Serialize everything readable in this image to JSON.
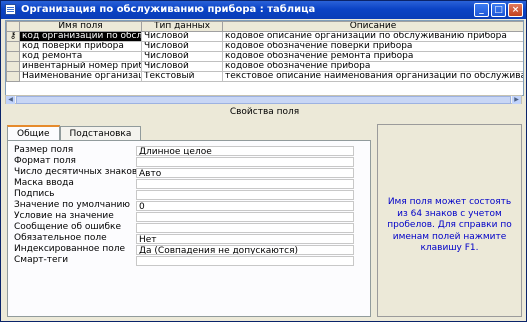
{
  "window": {
    "title": "Организация по обслуживанию прибора : таблица"
  },
  "grid": {
    "headers": [
      "Имя поля",
      "Тип данных",
      "Описание"
    ],
    "rows": [
      {
        "name": "код организации по обслуж",
        "type": "Числовой",
        "desc": "кодовое описание организации по обслуживанию прибора"
      },
      {
        "name": "код поверки прибора",
        "type": "Числовой",
        "desc": "кодовое обозначение поверки прибора"
      },
      {
        "name": "код ремонта",
        "type": "Числовой",
        "desc": "кодовое обозначение ремонта прибора"
      },
      {
        "name": "инвентарный номер прибор",
        "type": "Числовой",
        "desc": "кодовое обозначение прибора"
      },
      {
        "name": "Наименование организации",
        "type": "Текстовый",
        "desc": "текстовое описание наименования организации по обслуживанию п"
      }
    ]
  },
  "props": {
    "section_title": "Свойства поля",
    "tabs": [
      "Общие",
      "Подстановка"
    ],
    "items": [
      {
        "label": "Размер поля",
        "value": "Длинное целое"
      },
      {
        "label": "Формат поля",
        "value": ""
      },
      {
        "label": "Число десятичных знаков",
        "value": "Авто"
      },
      {
        "label": "Маска ввода",
        "value": ""
      },
      {
        "label": "Подпись",
        "value": ""
      },
      {
        "label": "Значение по умолчанию",
        "value": "0"
      },
      {
        "label": "Условие на значение",
        "value": ""
      },
      {
        "label": "Сообщение об ошибке",
        "value": ""
      },
      {
        "label": "Обязательное поле",
        "value": "Нет"
      },
      {
        "label": "Индексированное поле",
        "value": "Да (Совпадения не допускаются)"
      },
      {
        "label": "Смарт-теги",
        "value": ""
      }
    ]
  },
  "help": {
    "text": "Имя поля может состоять из 64 знаков с учетом пробелов. Для справки по именам полей нажмите клавишу F1."
  }
}
